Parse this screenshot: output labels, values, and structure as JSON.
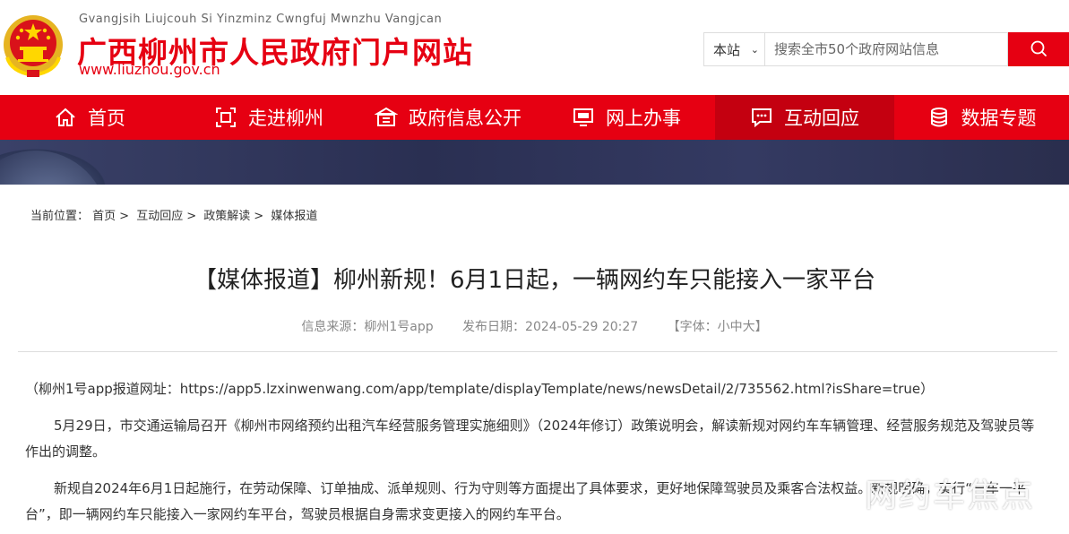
{
  "header": {
    "site_pinyin": "Gvangjsih Liujcouh Si Yinzminz Cwngfuj Mwnzhu Vangjcan",
    "site_title": "广西柳州市人民政府门户网站",
    "site_url": "www.liuzhou.gov.cn",
    "emblem_icon": "national-emblem-icon"
  },
  "search": {
    "scope": "本站",
    "placeholder": "搜索全市50个政府网站信息",
    "button_icon": "search-icon"
  },
  "nav": {
    "items": [
      {
        "label": "首页",
        "icon": "home-icon"
      },
      {
        "label": "走进柳州",
        "icon": "scan-icon"
      },
      {
        "label": "政府信息公开",
        "icon": "building-icon"
      },
      {
        "label": "网上办事",
        "icon": "monitor-icon"
      },
      {
        "label": "互动回应",
        "icon": "chat-icon",
        "active": true
      },
      {
        "label": "数据专题",
        "icon": "database-icon"
      }
    ]
  },
  "breadcrumb": {
    "prefix": "当前位置：",
    "items": [
      "首页",
      "互动回应",
      "政策解读",
      "媒体报道"
    ],
    "separator": ">"
  },
  "article": {
    "title": "【媒体报道】柳州新规！6月1日起，一辆网约车只能接入一家平台",
    "source": "信息来源：柳州1号app",
    "date": "发布日期：2024-05-29 20:27",
    "font_size": "【字体：小中大】",
    "paragraphs": [
      "（柳州1号app报道网址：https://app5.lzxinwenwang.com/app/template/displayTemplate/news/newsDetail/2/735562.html?isShare=true）",
      "5月29日，市交通运输局召开《柳州市网络预约出租汽车经营服务管理实施细则》（2024年修订）政策说明会，解读新规对网约车车辆管理、经营服务规范及驾驶员等作出的调整。",
      "新规自2024年6月1日起施行，在劳动保障、订单抽成、派单规则、行为守则等方面提出了具体要求，更好地保障驾驶员及乘客合法权益。新规明确，实行“一车一平台”，即一辆网约车只能接入一家网约车平台，驾驶员根据自身需求变更接入的网约车平台。"
    ]
  },
  "watermark": "网约车焦点",
  "colors": {
    "brand_red": "#e60012",
    "nav_active": "#c40010"
  }
}
